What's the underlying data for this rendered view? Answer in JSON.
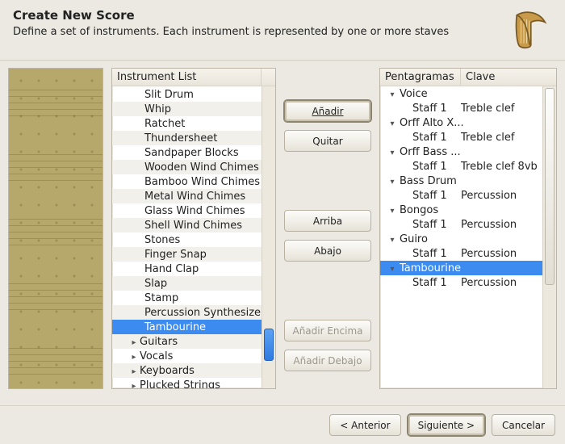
{
  "header": {
    "title": "Create New Score",
    "subtitle": "Define a set of instruments. Each instrument is represented by one or more staves"
  },
  "instrument_list": {
    "header": "Instrument List",
    "items": [
      {
        "label": "Slit Drum",
        "depth": 2
      },
      {
        "label": "Whip",
        "depth": 2
      },
      {
        "label": "Ratchet",
        "depth": 2
      },
      {
        "label": "Thundersheet",
        "depth": 2
      },
      {
        "label": "Sandpaper Blocks",
        "depth": 2
      },
      {
        "label": "Wooden Wind Chimes",
        "depth": 2
      },
      {
        "label": "Bamboo Wind Chimes",
        "depth": 2
      },
      {
        "label": "Metal Wind Chimes",
        "depth": 2
      },
      {
        "label": "Glass Wind Chimes",
        "depth": 2
      },
      {
        "label": "Shell Wind Chimes",
        "depth": 2
      },
      {
        "label": "Stones",
        "depth": 2
      },
      {
        "label": "Finger Snap",
        "depth": 2
      },
      {
        "label": "Hand Clap",
        "depth": 2
      },
      {
        "label": "Slap",
        "depth": 2
      },
      {
        "label": "Stamp",
        "depth": 2
      },
      {
        "label": "Percussion Synthesizer",
        "depth": 2
      },
      {
        "label": "Tambourine",
        "depth": 2,
        "selected": true
      },
      {
        "label": "Guitars",
        "depth": 1,
        "expandable": true
      },
      {
        "label": "Vocals",
        "depth": 1,
        "expandable": true
      },
      {
        "label": "Keyboards",
        "depth": 1,
        "expandable": true
      },
      {
        "label": "Plucked Strings",
        "depth": 1,
        "expandable": true
      }
    ]
  },
  "buttons": {
    "add": "Añadir",
    "remove": "Quitar",
    "up": "Arriba",
    "down": "Abajo",
    "add_above": "Añadir Encima",
    "add_below": "Añadir Debajo"
  },
  "right_panel": {
    "col_staves": "Pentagramas",
    "col_clef": "Clave",
    "groups": [
      {
        "name": "Voice",
        "staves": [
          {
            "name": "Staff 1",
            "clef": "Treble clef"
          }
        ]
      },
      {
        "name": "Orff Alto X...",
        "staves": [
          {
            "name": "Staff 1",
            "clef": "Treble clef"
          }
        ]
      },
      {
        "name": "Orff Bass ...",
        "staves": [
          {
            "name": "Staff 1",
            "clef": "Treble clef 8vb"
          }
        ]
      },
      {
        "name": "Bass Drum",
        "staves": [
          {
            "name": "Staff 1",
            "clef": "Percussion"
          }
        ]
      },
      {
        "name": "Bongos",
        "staves": [
          {
            "name": "Staff 1",
            "clef": "Percussion"
          }
        ]
      },
      {
        "name": "Guiro",
        "staves": [
          {
            "name": "Staff 1",
            "clef": "Percussion"
          }
        ]
      },
      {
        "name": "Tambourine",
        "selected": true,
        "staves": [
          {
            "name": "Staff 1",
            "clef": "Percussion"
          }
        ]
      }
    ]
  },
  "footer": {
    "back": "< Anterior",
    "next": "Siguiente >",
    "cancel": "Cancelar"
  }
}
